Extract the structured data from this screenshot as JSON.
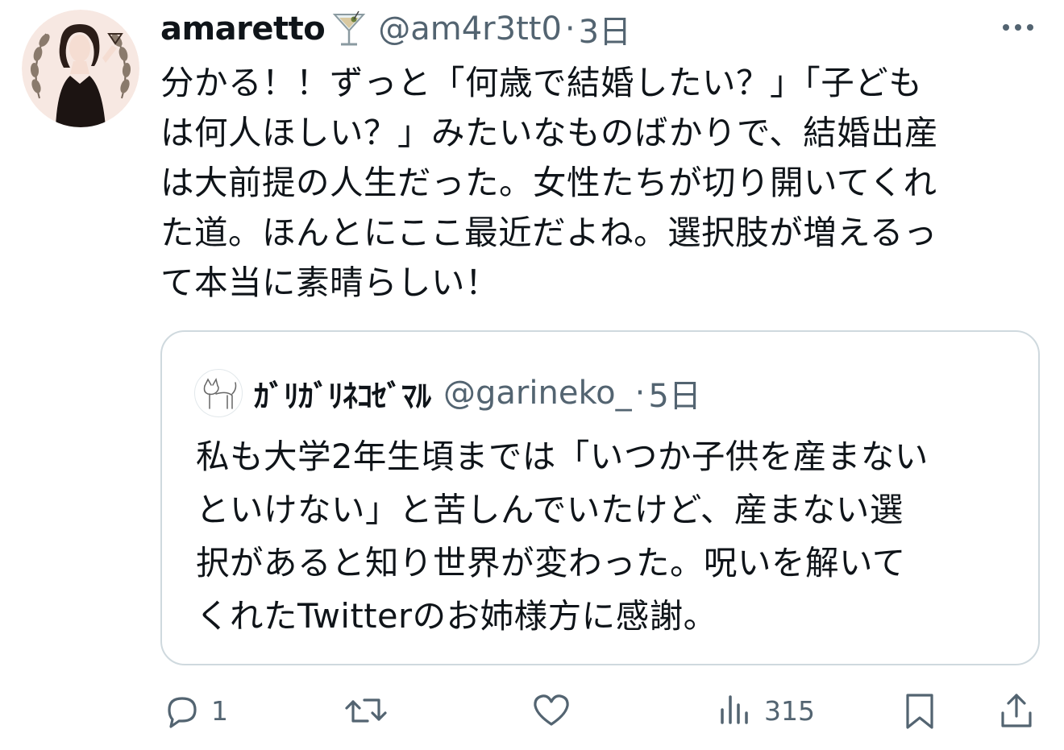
{
  "tweet": {
    "display_name": "amaretto",
    "name_emoji": "cocktail-glass-icon",
    "handle": "@am4r3tt0",
    "separator": "·",
    "time": "3日",
    "text": "分かる！！ずっと「何歳で結婚したい？」「子ども\nは何人ほしい？」みたいなものばかりで、結婚出産\nは大前提の人生だった。女性たちが切り開いてくれ\nた道。ほんとにここ最近だよね。選択肢が増えるっ\nて本当に素晴らしい！"
  },
  "quote": {
    "display_name": "ｶﾞﾘｶﾞﾘﾈｺｾﾞﾏﾙ",
    "handle": "@garineko_",
    "separator": "·",
    "time": "5日",
    "text": "私も大学2年生頃までは「いつか子供を産まない\nといけない」と苦しんでいたけど、産まない選\n択があると知り世界が変わった。呪いを解いて\nくれたTwitterのお姉様方に感謝。"
  },
  "actions": {
    "reply_count": "1",
    "views_count": "315"
  },
  "colors": {
    "text_primary": "#0f1419",
    "text_secondary": "#536471",
    "border": "#cfd9de"
  }
}
